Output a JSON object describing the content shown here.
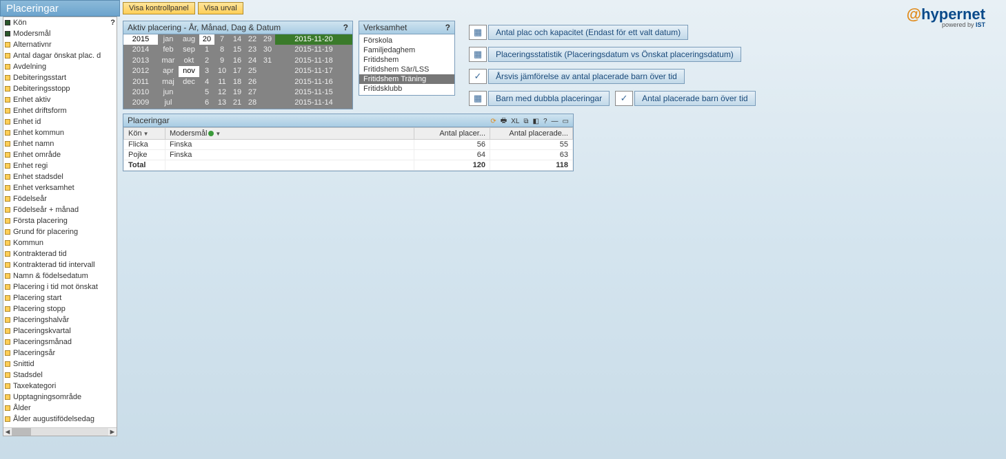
{
  "app": {
    "title": "Placeringar"
  },
  "toolbar": {
    "btn1": "Visa kontrollpanel",
    "btn2": "Visa urval"
  },
  "sidebar": {
    "items": [
      {
        "label": "Kön",
        "state": "filled"
      },
      {
        "label": "Modersmål",
        "state": "filled"
      },
      {
        "label": "Alternativnr",
        "state": "yellow"
      },
      {
        "label": "Antal dagar önskat plac. d",
        "state": "yellow"
      },
      {
        "label": "Avdelning",
        "state": "yellow"
      },
      {
        "label": "Debiteringsstart",
        "state": "yellow"
      },
      {
        "label": "Debiteringsstopp",
        "state": "yellow"
      },
      {
        "label": "Enhet aktiv",
        "state": "yellow"
      },
      {
        "label": "Enhet driftsform",
        "state": "yellow"
      },
      {
        "label": "Enhet id",
        "state": "yellow"
      },
      {
        "label": "Enhet kommun",
        "state": "yellow"
      },
      {
        "label": "Enhet namn",
        "state": "yellow"
      },
      {
        "label": "Enhet område",
        "state": "yellow"
      },
      {
        "label": "Enhet regi",
        "state": "yellow"
      },
      {
        "label": "Enhet stadsdel",
        "state": "yellow"
      },
      {
        "label": "Enhet verksamhet",
        "state": "yellow"
      },
      {
        "label": "Födelseår",
        "state": "yellow"
      },
      {
        "label": "Födelseår + månad",
        "state": "yellow"
      },
      {
        "label": "Första placering",
        "state": "yellow"
      },
      {
        "label": "Grund för placering",
        "state": "yellow"
      },
      {
        "label": "Kommun",
        "state": "yellow"
      },
      {
        "label": "Kontrakterad tid",
        "state": "yellow"
      },
      {
        "label": "Kontrakterad tid intervall",
        "state": "yellow"
      },
      {
        "label": "Namn & födelsedatum",
        "state": "yellow"
      },
      {
        "label": "Placering i tid mot önskat",
        "state": "yellow"
      },
      {
        "label": "Placering start",
        "state": "yellow"
      },
      {
        "label": "Placering stopp",
        "state": "yellow"
      },
      {
        "label": "Placeringshalvår",
        "state": "yellow"
      },
      {
        "label": "Placeringskvartal",
        "state": "yellow"
      },
      {
        "label": "Placeringsmånad",
        "state": "yellow"
      },
      {
        "label": "Placeringsår",
        "state": "yellow"
      },
      {
        "label": "Snittid",
        "state": "yellow"
      },
      {
        "label": "Stadsdel",
        "state": "yellow"
      },
      {
        "label": "Taxekategori",
        "state": "yellow"
      },
      {
        "label": "Upptagningsområde",
        "state": "yellow"
      },
      {
        "label": "Ålder",
        "state": "yellow"
      },
      {
        "label": "Ålder augustifödelsedag",
        "state": "yellow"
      }
    ]
  },
  "datePanel": {
    "title": "Aktiv placering - År, Månad, Dag & Datum",
    "years": [
      "2015",
      "2014",
      "2013",
      "2012",
      "2011",
      "2010",
      "2009"
    ],
    "yearSelected": "2015",
    "months1": [
      "jan",
      "feb",
      "mar",
      "apr",
      "maj",
      "jun",
      "jul"
    ],
    "months2": [
      "aug",
      "sep",
      "okt",
      "nov",
      "dec"
    ],
    "monthSelected": "nov",
    "days": [
      [
        "20",
        "7",
        "14",
        "22",
        "29"
      ],
      [
        "1",
        "8",
        "15",
        "23",
        "30"
      ],
      [
        "2",
        "9",
        "16",
        "24",
        "31"
      ],
      [
        "3",
        "10",
        "17",
        "25",
        ""
      ],
      [
        "4",
        "11",
        "18",
        "26",
        ""
      ],
      [
        "5",
        "12",
        "19",
        "27",
        ""
      ],
      [
        "6",
        "13",
        "21",
        "28",
        ""
      ]
    ],
    "daySelected": "20",
    "dates": [
      "2015-11-20",
      "2015-11-19",
      "2015-11-18",
      "2015-11-17",
      "2015-11-16",
      "2015-11-15",
      "2015-11-14"
    ],
    "dateSelected": "2015-11-20"
  },
  "verksamhet": {
    "title": "Verksamhet",
    "items": [
      "Förskola",
      "Familjedaghem",
      "Fritidshem",
      "Fritidshem Sär/LSS",
      "Fritidshem Träning",
      "Fritidsklubb"
    ],
    "selected": "Fritidshem Träning"
  },
  "actions": {
    "a1": "Antal plac och kapacitet (Endast för ett valt datum)",
    "a2": "Placeringsstatistik (Placeringsdatum vs Önskat placeringsdatum)",
    "a3": "Årsvis jämförelse av antal placerade barn över tid",
    "a4": "Barn med dubbla placeringar",
    "a5": "Antal placerade barn över tid"
  },
  "results": {
    "title": "Placeringar",
    "columns": [
      "Kön",
      "Modersmål",
      "Antal placer...",
      "Antal placerade..."
    ],
    "rows": [
      {
        "kon": "Flicka",
        "modersmal": "Finska",
        "v1": "56",
        "v2": "55"
      },
      {
        "kon": "Pojke",
        "modersmal": "Finska",
        "v1": "64",
        "v2": "63"
      }
    ],
    "total": {
      "label": "Total",
      "v1": "120",
      "v2": "118"
    },
    "toolbarLabels": {
      "xl": "XL"
    }
  },
  "logo": {
    "brand": "hypernet",
    "sub": "powered by",
    "ist": " IST"
  }
}
